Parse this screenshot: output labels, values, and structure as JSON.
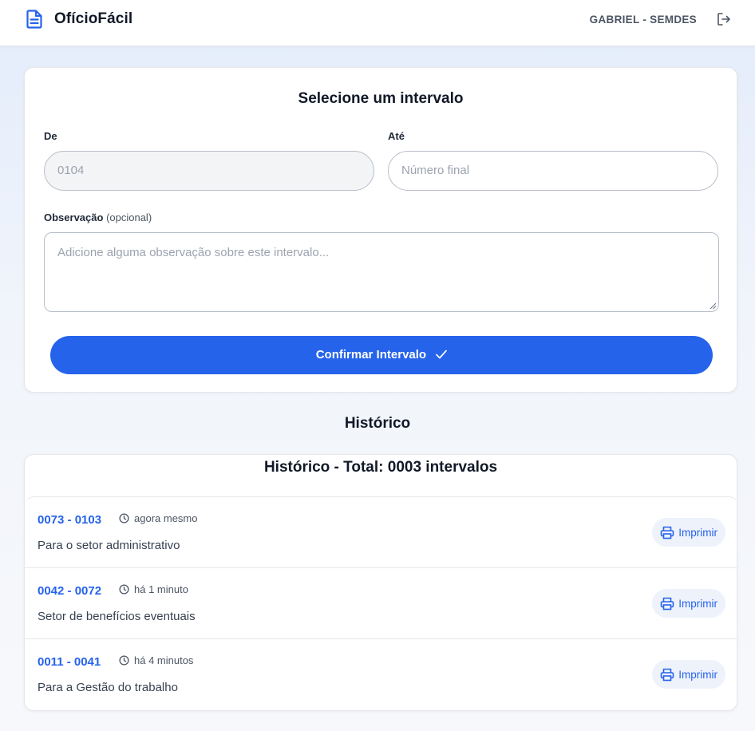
{
  "header": {
    "app_title": "OfícioFácil",
    "user": "GABRIEL - SEMDES",
    "accent_color": "#2563eb"
  },
  "form": {
    "title": "Selecione um intervalo",
    "from_label": "De",
    "from_value": "0104",
    "to_label": "Até",
    "to_placeholder": "Número final",
    "note_label": "Observação",
    "note_optional": "(opcional)",
    "note_placeholder": "Adicione alguma observação sobre este intervalo...",
    "confirm_label": "Confirmar Intervalo"
  },
  "history": {
    "section_title": "Histórico",
    "total_title": "Histórico - Total: 0003 intervalos",
    "items": [
      {
        "range": "0073 - 0103",
        "time": "agora mesmo",
        "note": "Para o setor administrativo",
        "action": "Imprimir"
      },
      {
        "range": "0042 - 0072",
        "time": "há 1 minuto",
        "note": "Setor de benefícios eventuais",
        "action": "Imprimir"
      },
      {
        "range": "0011 - 0041",
        "time": "há 4 minutos",
        "note": "Para a Gestão do trabalho",
        "action": "Imprimir"
      }
    ]
  }
}
